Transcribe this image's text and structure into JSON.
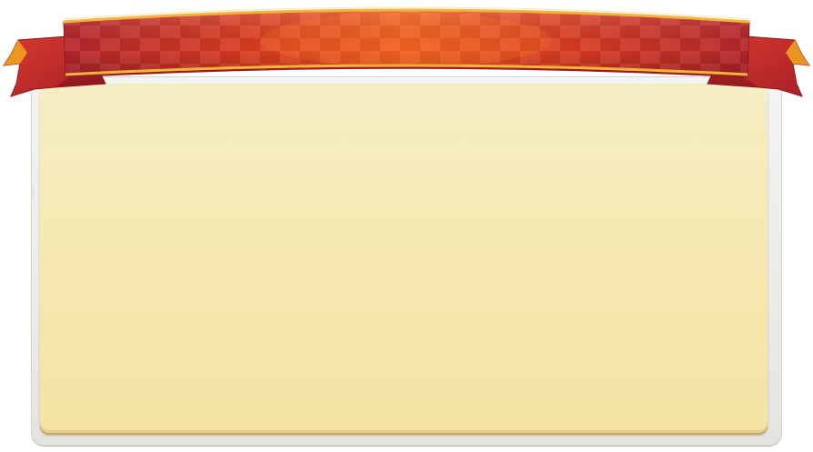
{
  "theme": {
    "ribbon_red": "#c8282c",
    "ribbon_orange": "#f25a1e",
    "ribbon_gold": "#f2a81e",
    "parchment_top": "#f5eec4",
    "parchment_bottom": "#f4e3a4",
    "frame": "#ecebe8"
  },
  "icons": {
    "ribbon_left_tail": "ribbon-tail",
    "ribbon_right_tail": "ribbon-tail"
  }
}
